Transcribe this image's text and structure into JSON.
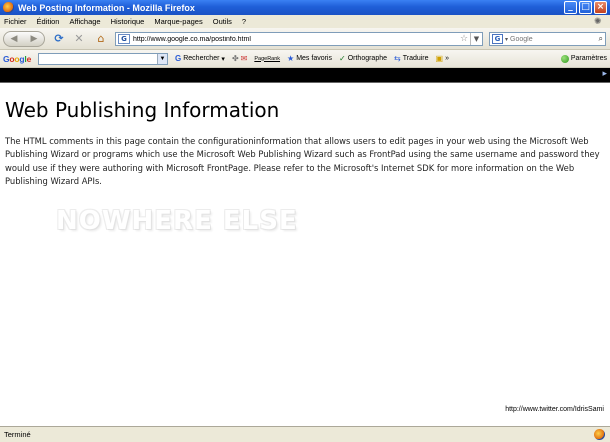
{
  "window": {
    "title": "Web Posting Information - Mozilla Firefox",
    "controls": {
      "minimize": "_",
      "maximize": "□",
      "close": "×"
    }
  },
  "menu": [
    "Fichier",
    "Édition",
    "Affichage",
    "Historique",
    "Marque-pages",
    "Outils",
    "?"
  ],
  "navigation": {
    "url": "http://www.google.co.ma/postinfo.html",
    "search_placeholder": "Google"
  },
  "google_toolbar": {
    "logo": "Google",
    "items": {
      "rechercher": "Rechercher",
      "pagerank": "PageRank",
      "mes_favoris": "Mes favoris",
      "orthographe": "Orthographe",
      "traduire": "Traduire",
      "more": "»",
      "parametres": "Paramètres"
    }
  },
  "page": {
    "heading": "Web Publishing Information",
    "paragraph": "The HTML comments in this page contain the configurationinformation that allows users to edit pages in your web using the Microsoft Web Publishing Wizard or programs which use the Microsoft Web Publishing Wizard such as FrontPad using the same username and password they would use if they were authoring with Microsoft FrontPage. Please refer to the Microsoft's Internet SDK for more information on the Web Publishing Wizard APIs.",
    "watermark": "NOWHERE ELSE",
    "credit": "http://www.twitter.com/IdrisSami"
  },
  "status": {
    "text": "Terminé"
  },
  "icons": [
    "firefox-icon",
    "back-icon",
    "forward-icon",
    "reload-icon",
    "stop-icon",
    "home-icon",
    "bookmark-star-icon",
    "search-icon",
    "google-icon"
  ]
}
